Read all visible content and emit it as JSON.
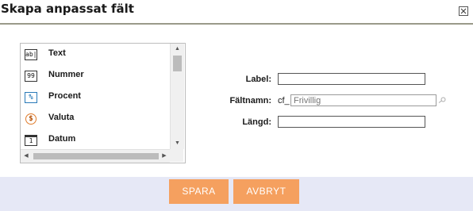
{
  "dialog": {
    "title": "Skapa anpassat fält",
    "close_icon": "close-icon"
  },
  "field_types": [
    {
      "label": "Text",
      "icon": "text-field-icon",
      "glyph": "ab|"
    },
    {
      "label": "Nummer",
      "icon": "number-field-icon",
      "glyph": "99"
    },
    {
      "label": "Procent",
      "icon": "percent-field-icon",
      "glyph": "%"
    },
    {
      "label": "Valuta",
      "icon": "currency-field-icon",
      "glyph": "$"
    },
    {
      "label": "Datum",
      "icon": "date-field-icon",
      "glyph": "1"
    }
  ],
  "form": {
    "label_label": "Label:",
    "label_value": "",
    "fieldname_label": "Fältnamn:",
    "fieldname_prefix": "cf_",
    "fieldname_placeholder": "Frivillig",
    "length_label": "Längd:",
    "length_value": ""
  },
  "footer": {
    "save_label": "SPARA",
    "cancel_label": "AVBRYT",
    "button_color": "#f5a05f",
    "footer_color": "#e6e8f6"
  }
}
